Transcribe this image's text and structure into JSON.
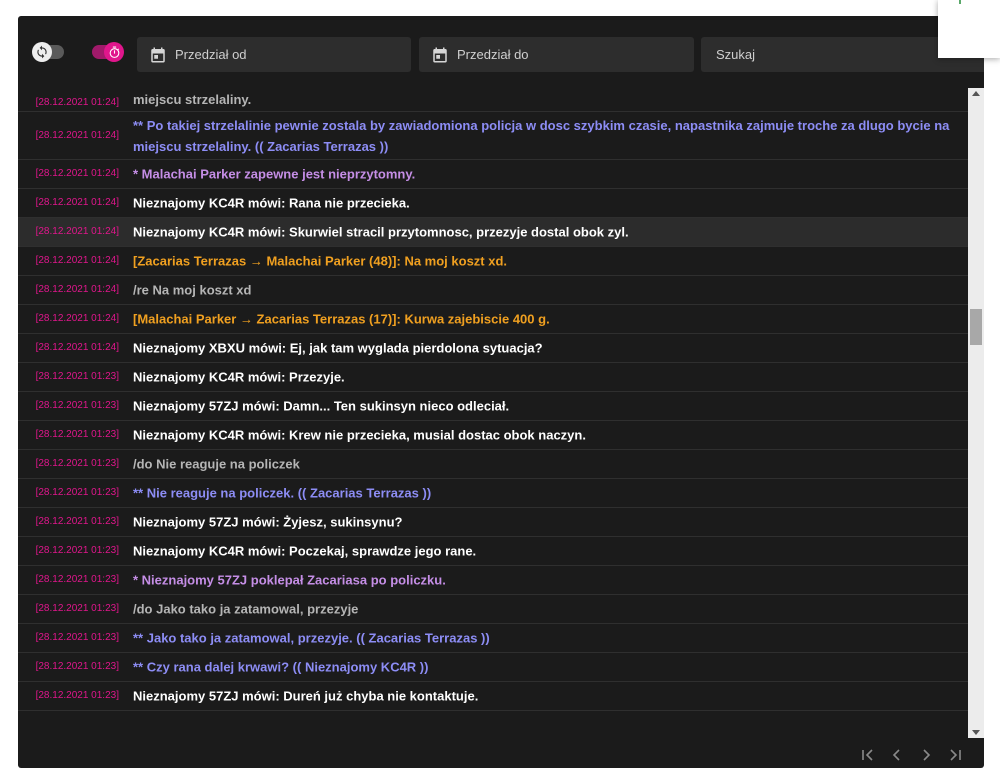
{
  "toolbar": {
    "date_from_placeholder": "Przedział od",
    "date_to_placeholder": "Przedział do",
    "search_placeholder": "Szukaj"
  },
  "colors": {
    "timestamp": "#e0168c",
    "say": "#ffffff",
    "me": "#c58ee6",
    "do": "#8d8df5",
    "pm": "#f0a020",
    "ooc": "#b5b5b5"
  },
  "messages": [
    {
      "time": "[28.12.2021 01:24]",
      "text": "miejscu strzelaliny.",
      "kind": "ooc"
    },
    {
      "time": "[28.12.2021 01:24]",
      "text": "** Po takiej strzelalinie pewnie zostala by zawiadomiona policja w dosc szybkim czasie, napastnika zajmuje troche za dlugo bycie na miejscu strzelaliny. (( Zacarias Terrazas ))",
      "kind": "do"
    },
    {
      "time": "[28.12.2021 01:24]",
      "text": "* Malachai Parker zapewne jest nieprzytomny.",
      "kind": "me"
    },
    {
      "time": "[28.12.2021 01:24]",
      "text": "Nieznajomy KC4R mówi: Rana nie przecieka.",
      "kind": "say"
    },
    {
      "time": "[28.12.2021 01:24]",
      "text": "Nieznajomy KC4R mówi: Skurwiel stracil przytomnosc, przezyje dostal obok zyl.",
      "kind": "say"
    },
    {
      "time": "[28.12.2021 01:24]",
      "text": "[Zacarias Terrazas → Malachai Parker (48)]: Na moj koszt xd.",
      "kind": "pm"
    },
    {
      "time": "[28.12.2021 01:24]",
      "text": "/re Na moj koszt xd",
      "kind": "ooc"
    },
    {
      "time": "[28.12.2021 01:24]",
      "text": "[Malachai Parker → Zacarias Terrazas (17)]: Kurwa zajebiscie 400 g.",
      "kind": "pm"
    },
    {
      "time": "[28.12.2021 01:24]",
      "text": "Nieznajomy XBXU mówi: Ej, jak tam wyglada pierdolona sytuacja?",
      "kind": "say"
    },
    {
      "time": "[28.12.2021 01:23]",
      "text": "Nieznajomy KC4R mówi: Przezyje.",
      "kind": "say"
    },
    {
      "time": "[28.12.2021 01:23]",
      "text": "Nieznajomy 57ZJ mówi: Damn... Ten sukinsyn nieco odleciał.",
      "kind": "say"
    },
    {
      "time": "[28.12.2021 01:23]",
      "text": "Nieznajomy KC4R mówi: Krew nie przecieka, musial dostac obok naczyn.",
      "kind": "say"
    },
    {
      "time": "[28.12.2021 01:23]",
      "text": "/do Nie reaguje na policzek",
      "kind": "ooc"
    },
    {
      "time": "[28.12.2021 01:23]",
      "text": "** Nie reaguje na policzek. (( Zacarias Terrazas ))",
      "kind": "do"
    },
    {
      "time": "[28.12.2021 01:23]",
      "text": "Nieznajomy 57ZJ mówi: Żyjesz, sukinsynu?",
      "kind": "say"
    },
    {
      "time": "[28.12.2021 01:23]",
      "text": "Nieznajomy KC4R mówi: Poczekaj, sprawdze jego rane.",
      "kind": "say"
    },
    {
      "time": "[28.12.2021 01:23]",
      "text": "* Nieznajomy 57ZJ poklepał Zacariasa po policzku.",
      "kind": "me"
    },
    {
      "time": "[28.12.2021 01:23]",
      "text": "/do Jako tako ja zatamowal, przezyje",
      "kind": "ooc"
    },
    {
      "time": "[28.12.2021 01:23]",
      "text": "** Jako tako ja zatamowal, przezyje. (( Zacarias Terrazas ))",
      "kind": "do"
    },
    {
      "time": "[28.12.2021 01:23]",
      "text": "** Czy rana dalej krwawi? (( Nieznajomy KC4R ))",
      "kind": "do"
    },
    {
      "time": "[28.12.2021 01:23]",
      "text": "Nieznajomy 57ZJ mówi: Dureń już chyba nie kontaktuje.",
      "kind": "say"
    }
  ]
}
